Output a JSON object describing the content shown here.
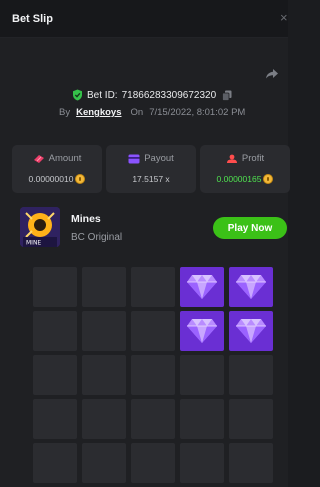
{
  "header": {
    "title": "Bet Slip",
    "close_glyph": "×"
  },
  "bet": {
    "id_label": "Bet ID:",
    "id_value": "71866283309672320",
    "by": "By",
    "user": "Kengkoys",
    "on": "On",
    "datetime": "7/15/2022, 8:01:02 PM"
  },
  "stats": {
    "amount": {
      "label": "Amount",
      "value": "0.00000010"
    },
    "payout": {
      "label": "Payout",
      "value": "17.5157 x"
    },
    "profit": {
      "label": "Profit",
      "value": "0.00000165"
    }
  },
  "game": {
    "name": "Mines",
    "subtitle": "BC Original",
    "play_label": "Play Now",
    "thumb_text": "MINE"
  },
  "colors": {
    "profit_green": "#4fe24f",
    "play_green": "#3bc117",
    "gem_purple": "#6a2fd3",
    "shield_green": "#35c24a"
  },
  "grid": {
    "rows_visible": 5,
    "cols": 5,
    "gems_revealed": [
      [
        0,
        3
      ],
      [
        0,
        4
      ],
      [
        1,
        3
      ],
      [
        1,
        4
      ]
    ]
  }
}
